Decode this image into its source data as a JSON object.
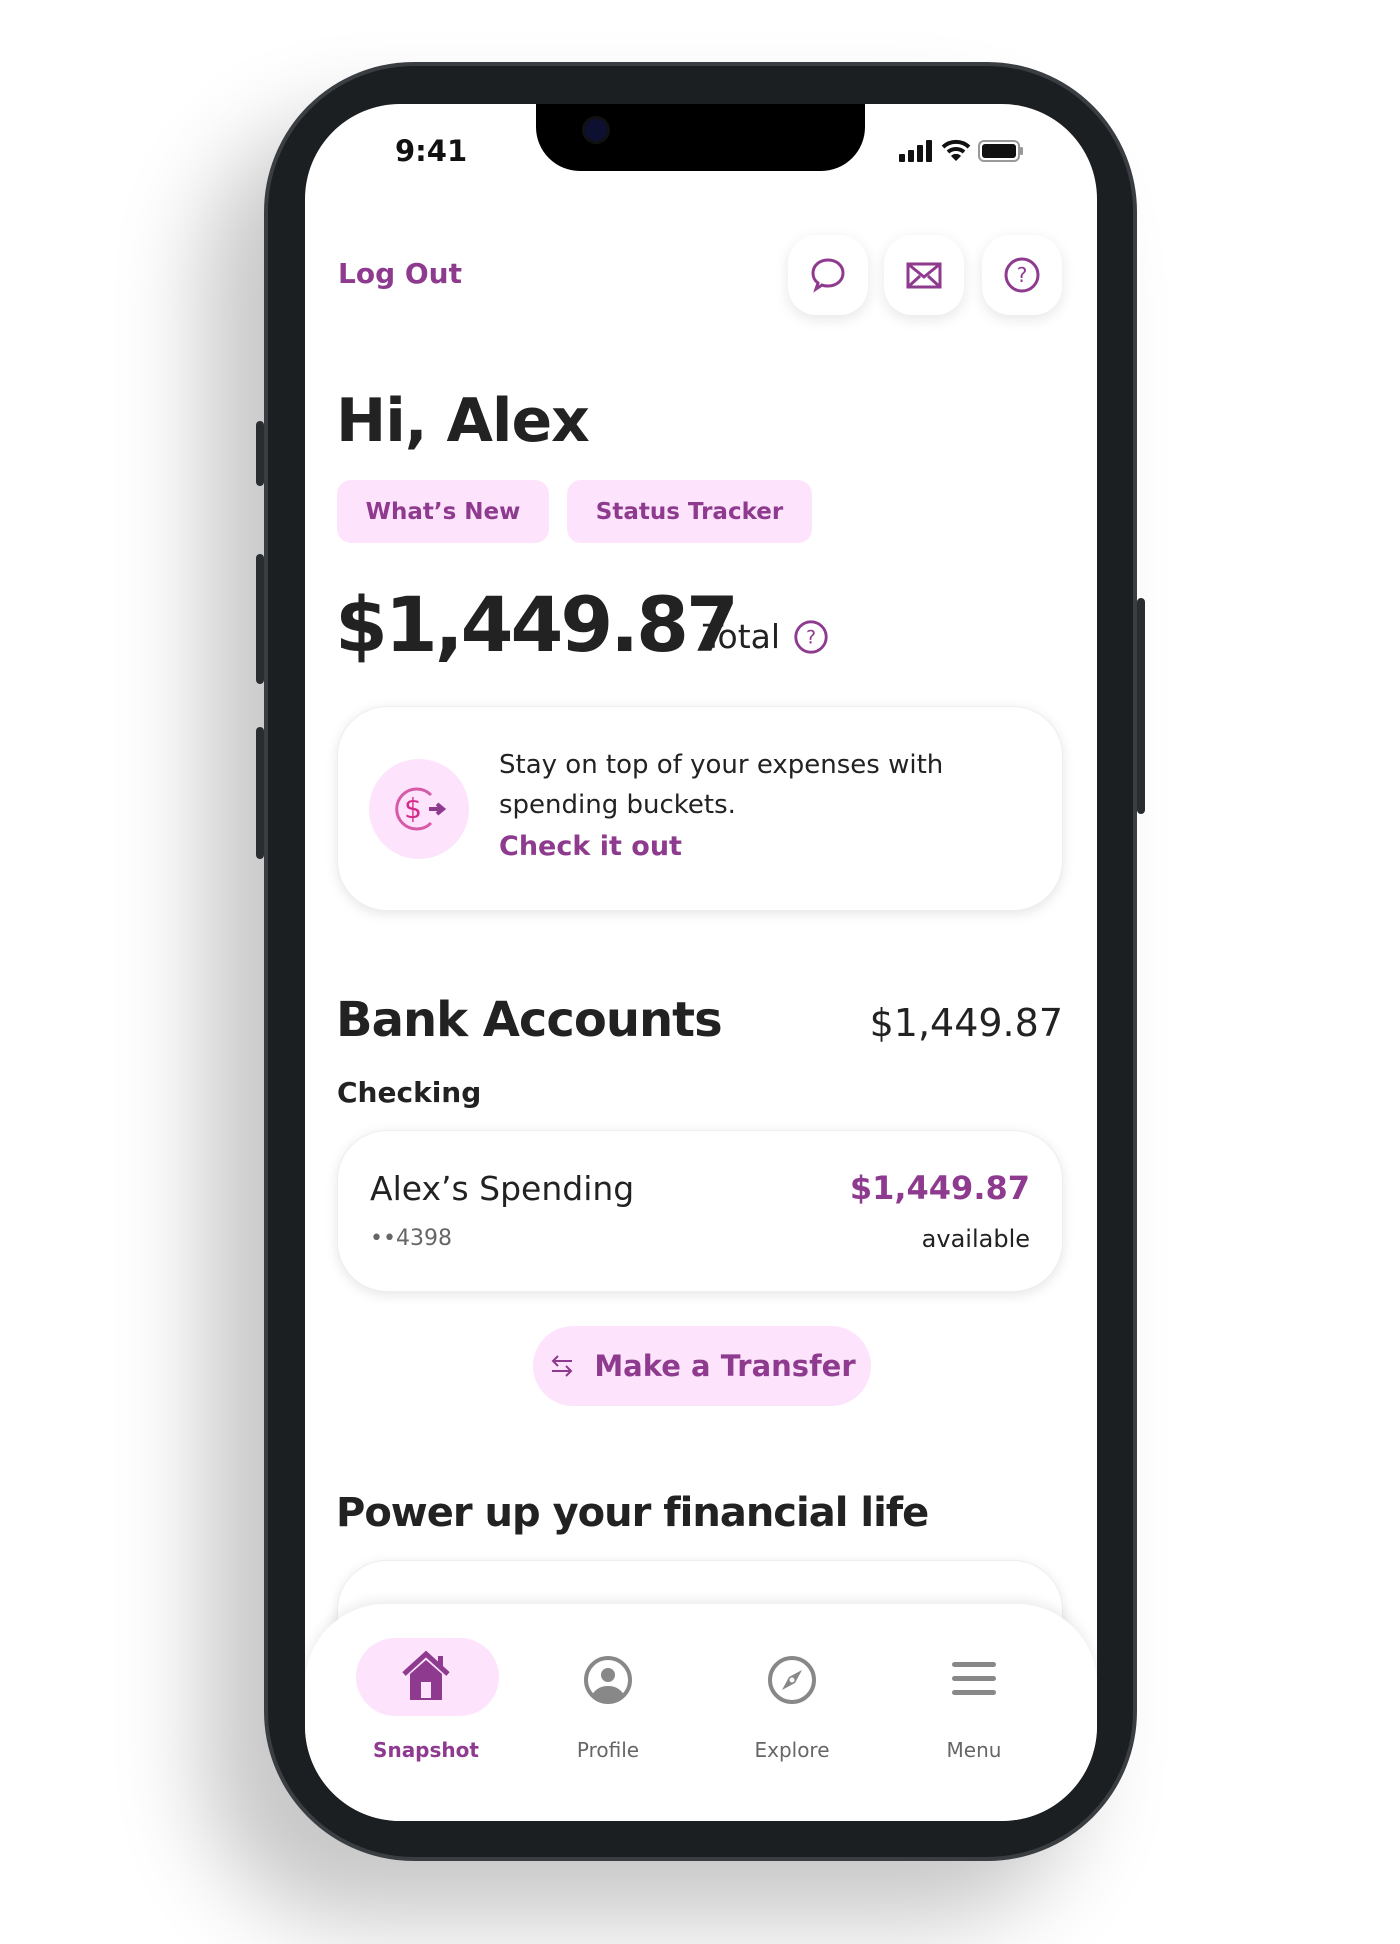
{
  "status_bar": {
    "time": "9:41"
  },
  "header": {
    "logout_label": "Log Out",
    "icons": [
      "chat-bubble-icon",
      "mail-icon",
      "help-icon"
    ]
  },
  "greeting": "Hi, Alex",
  "chips": [
    "What’s New",
    "Status Tracker"
  ],
  "total": {
    "amount": "$1,449.87",
    "label": "Total",
    "icon": "help-icon"
  },
  "promo": {
    "line1": "Stay on top of your expenses with",
    "line2": "spending buckets.",
    "link": "Check it out",
    "icon": "dollar-arrow-icon"
  },
  "bank": {
    "title": "Bank Accounts",
    "total": "$1,449.87",
    "section": "Checking",
    "account": {
      "name": "Alex’s Spending",
      "mask": "••4398",
      "balance": "$1,449.87",
      "balance_label": "available"
    }
  },
  "transfer_label": "Make a Transfer",
  "power_heading": "Power up your financial life",
  "tabbar": {
    "items": [
      {
        "label": "Snapshot",
        "icon": "home-icon",
        "active": true
      },
      {
        "label": "Profile",
        "icon": "profile-icon"
      },
      {
        "label": "Explore",
        "icon": "compass-icon"
      },
      {
        "label": "Menu",
        "icon": "menu-icon"
      }
    ]
  },
  "colors": {
    "accent": "#8e3a8f",
    "chip_bg": "#fde4fc",
    "text": "#222222"
  }
}
